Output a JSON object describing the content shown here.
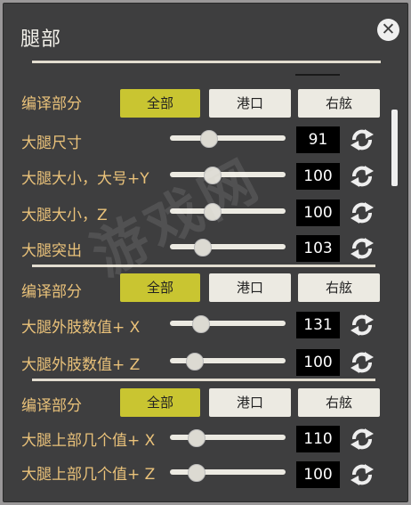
{
  "title": "腿部",
  "close_icon": "close-icon",
  "groups": [
    {
      "label": "编译部分",
      "buttons": [
        {
          "label": "全部",
          "active": true
        },
        {
          "label": "港口",
          "active": false
        },
        {
          "label": "右舷",
          "active": false
        }
      ],
      "rows": [
        {
          "label": "大腿尺寸",
          "value": "91",
          "level": 0.33
        },
        {
          "label": "大腿大小，大号+Y",
          "value": "100",
          "level": 0.36
        },
        {
          "label": "大腿大小，Z",
          "value": "100",
          "level": 0.36
        },
        {
          "label": "大腿突出",
          "value": "103",
          "level": 0.28
        }
      ]
    },
    {
      "label": "编译部分",
      "buttons": [
        {
          "label": "全部",
          "active": true
        },
        {
          "label": "港口",
          "active": false
        },
        {
          "label": "右舷",
          "active": false
        }
      ],
      "rows": [
        {
          "label": "大腿外肢数值+ X",
          "value": "131",
          "level": 0.26
        },
        {
          "label": "大腿外肢数值+ Z",
          "value": "100",
          "level": 0.21
        }
      ]
    },
    {
      "label": "编译部分",
      "buttons": [
        {
          "label": "全部",
          "active": true
        },
        {
          "label": "港口",
          "active": false
        },
        {
          "label": "右舷",
          "active": false
        }
      ],
      "rows": [
        {
          "label": "大腿上部几个值+ X",
          "value": "110",
          "level": 0.22
        },
        {
          "label": "大腿上部几个值+ Z",
          "value": "100",
          "level": 0.22
        }
      ]
    }
  ],
  "colors": {
    "panel": "#3e3e3f",
    "label": "#eac27a",
    "active_button": "#c9c531",
    "button": "#eceae2",
    "value_bg": "#000000"
  },
  "reset_icon": "reset-arrows-icon"
}
